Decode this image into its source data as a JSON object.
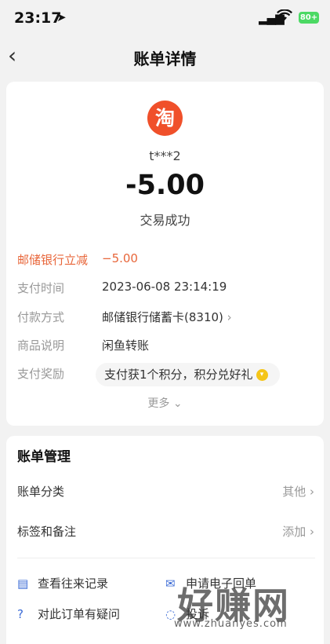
{
  "status_bar": {
    "time": "23:17",
    "battery": "80+"
  },
  "header": {
    "title": "账单详情"
  },
  "summary": {
    "merchant_logo_char": "淘",
    "user": "t***2",
    "amount": "-5.00",
    "status": "交易成功"
  },
  "details": [
    {
      "label": "邮储银行立减",
      "value": "−5.00"
    },
    {
      "label": "支付时间",
      "value": "2023-06-08 23:14:19"
    },
    {
      "label": "付款方式",
      "value": "邮储银行储蓄卡(8310)"
    },
    {
      "label": "商品说明",
      "value": "闲鱼转账"
    },
    {
      "label": "支付奖励",
      "value": "支付获1个积分，积分兑好礼"
    }
  ],
  "more_label": "更多",
  "management": {
    "title": "账单管理",
    "rows": [
      {
        "label": "账单分类",
        "value": "其他"
      },
      {
        "label": "标签和备注",
        "value": "添加"
      }
    ],
    "actions": [
      "查看往来记录",
      "申请电子回单",
      "对此订单有疑问",
      "投诉"
    ]
  },
  "watermark": {
    "text": "好赚网",
    "url": "www.zhuanyes.com"
  },
  "colors": {
    "accent": "#3b6bd6",
    "discount": "#e8663a",
    "taobao": "#f0502a"
  }
}
